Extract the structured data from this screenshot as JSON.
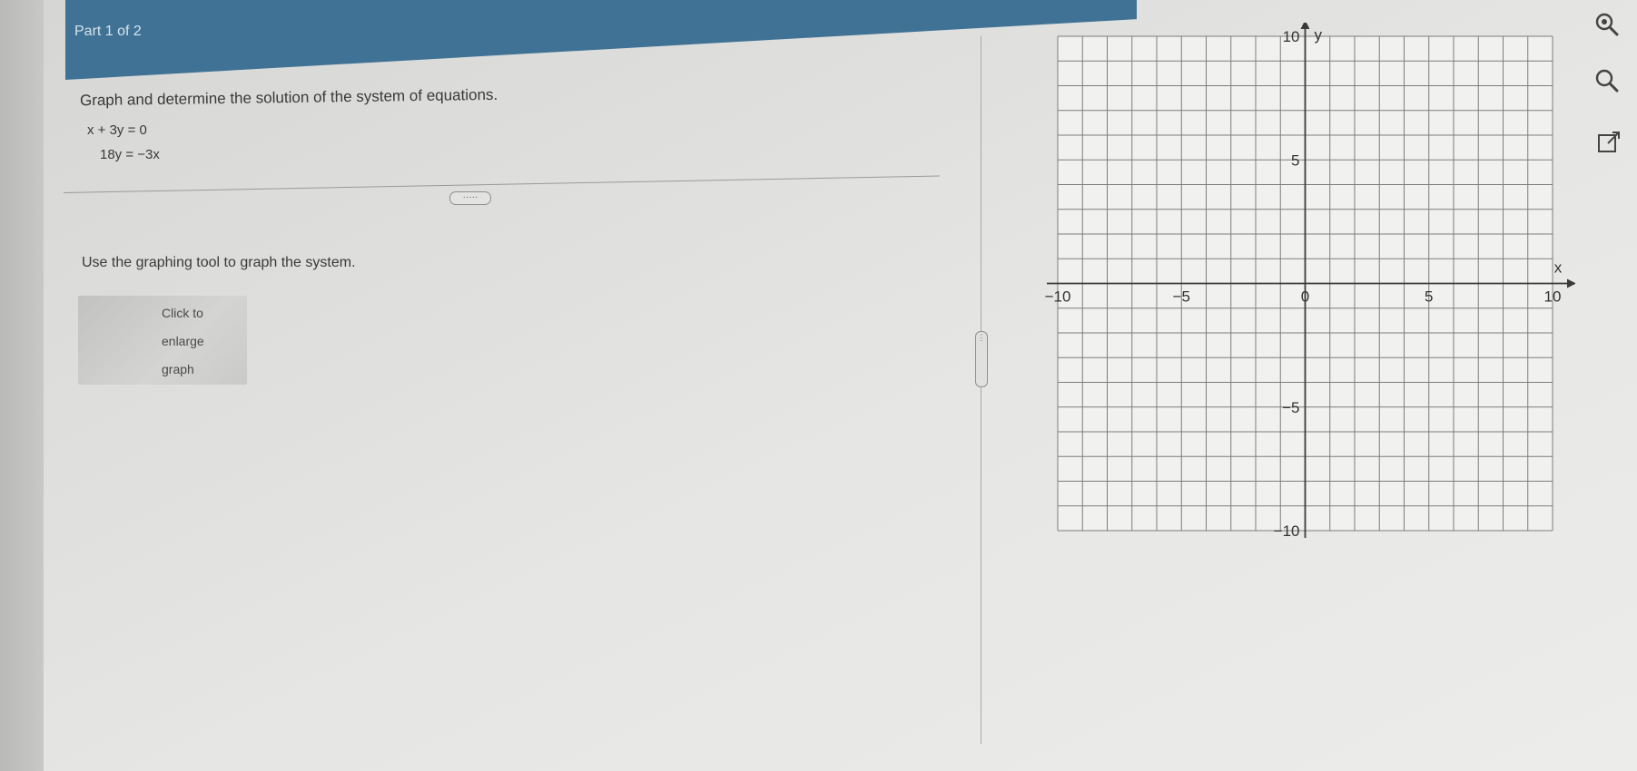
{
  "header": {
    "part_label": "Part 1 of 2"
  },
  "problem": {
    "instructions": "Graph and determine the solution of the system of equations.",
    "equations": [
      "x + 3y = 0",
      "18y = −3x"
    ]
  },
  "expand_handle_label": "·····",
  "prompt": "Use the graphing tool to graph the system.",
  "thumbnail": {
    "label_lines": [
      "Click to",
      "enlarge",
      "graph"
    ]
  },
  "graph": {
    "x_axis_label": "x",
    "y_axis_label": "y",
    "x_range": [
      -10,
      10
    ],
    "y_range": [
      -10,
      10
    ],
    "tick_labels": {
      "x": [
        "−10",
        "−5",
        "0",
        "5",
        "10"
      ],
      "y": [
        "10",
        "5",
        "−5",
        "−10"
      ]
    },
    "grid": true
  },
  "toolbar": {
    "icons": [
      "zoom-in-icon",
      "zoom-out-icon",
      "popout-icon"
    ]
  },
  "colors": {
    "header": "#3f7295",
    "grid": "#7d7d7b",
    "axis": "#3a3a3a"
  }
}
